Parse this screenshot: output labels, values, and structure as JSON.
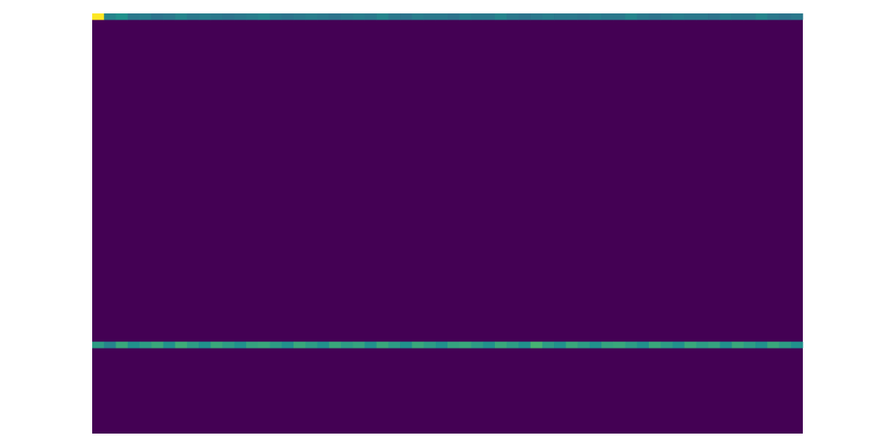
{
  "chart_data": {
    "type": "heatmap",
    "title": "",
    "xlabel": "",
    "ylabel": "",
    "axes_visible": false,
    "colormap": "viridis",
    "background_value": 0.0,
    "grid": {
      "columns": 60,
      "rows": 64
    },
    "highlighted_rows": [
      {
        "row": 0,
        "values": [
          1.0,
          0.45,
          0.5,
          0.4,
          0.42,
          0.38,
          0.4,
          0.45,
          0.4,
          0.42,
          0.4,
          0.38,
          0.4,
          0.42,
          0.45,
          0.4,
          0.38,
          0.4,
          0.42,
          0.4,
          0.38,
          0.4,
          0.42,
          0.4,
          0.45,
          0.4,
          0.38,
          0.42,
          0.4,
          0.4,
          0.38,
          0.42,
          0.4,
          0.4,
          0.45,
          0.4,
          0.38,
          0.4,
          0.42,
          0.4,
          0.4,
          0.38,
          0.42,
          0.4,
          0.4,
          0.45,
          0.4,
          0.38,
          0.4,
          0.42,
          0.4,
          0.4,
          0.38,
          0.42,
          0.4,
          0.4,
          0.45,
          0.4,
          0.38,
          0.4
        ]
      },
      {
        "row": 50,
        "values": [
          0.55,
          0.45,
          0.6,
          0.5,
          0.55,
          0.6,
          0.5,
          0.62,
          0.55,
          0.5,
          0.6,
          0.55,
          0.5,
          0.58,
          0.6,
          0.55,
          0.5,
          0.6,
          0.55,
          0.5,
          0.6,
          0.55,
          0.58,
          0.5,
          0.6,
          0.55,
          0.5,
          0.6,
          0.55,
          0.5,
          0.58,
          0.6,
          0.55,
          0.5,
          0.6,
          0.55,
          0.5,
          0.65,
          0.55,
          0.5,
          0.6,
          0.55,
          0.5,
          0.58,
          0.6,
          0.55,
          0.5,
          0.6,
          0.55,
          0.5,
          0.6,
          0.55,
          0.58,
          0.5,
          0.6,
          0.55,
          0.5,
          0.6,
          0.55,
          0.5
        ]
      }
    ]
  }
}
